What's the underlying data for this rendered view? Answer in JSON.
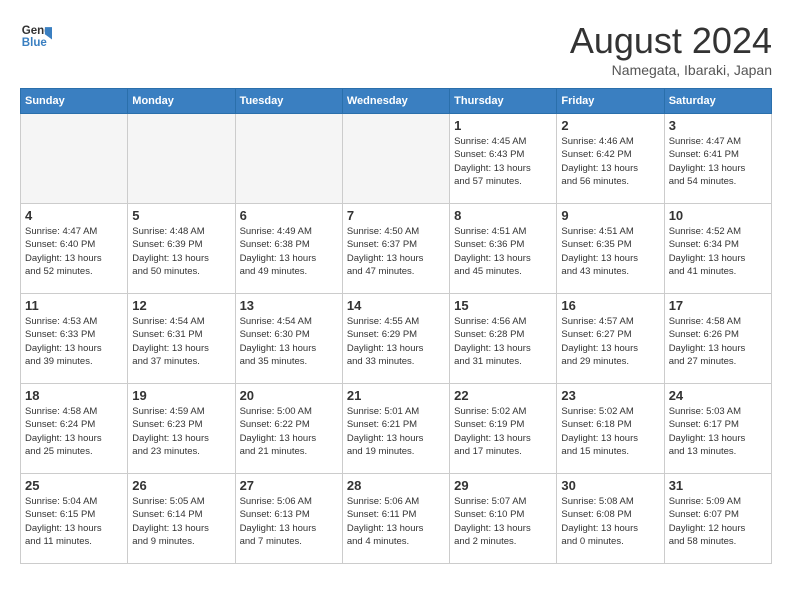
{
  "logo": {
    "line1": "General",
    "line2": "Blue"
  },
  "title": "August 2024",
  "subtitle": "Namegata, Ibaraki, Japan",
  "days_of_week": [
    "Sunday",
    "Monday",
    "Tuesday",
    "Wednesday",
    "Thursday",
    "Friday",
    "Saturday"
  ],
  "weeks": [
    [
      {
        "day": "",
        "info": ""
      },
      {
        "day": "",
        "info": ""
      },
      {
        "day": "",
        "info": ""
      },
      {
        "day": "",
        "info": ""
      },
      {
        "day": "1",
        "info": "Sunrise: 4:45 AM\nSunset: 6:43 PM\nDaylight: 13 hours\nand 57 minutes."
      },
      {
        "day": "2",
        "info": "Sunrise: 4:46 AM\nSunset: 6:42 PM\nDaylight: 13 hours\nand 56 minutes."
      },
      {
        "day": "3",
        "info": "Sunrise: 4:47 AM\nSunset: 6:41 PM\nDaylight: 13 hours\nand 54 minutes."
      }
    ],
    [
      {
        "day": "4",
        "info": "Sunrise: 4:47 AM\nSunset: 6:40 PM\nDaylight: 13 hours\nand 52 minutes."
      },
      {
        "day": "5",
        "info": "Sunrise: 4:48 AM\nSunset: 6:39 PM\nDaylight: 13 hours\nand 50 minutes."
      },
      {
        "day": "6",
        "info": "Sunrise: 4:49 AM\nSunset: 6:38 PM\nDaylight: 13 hours\nand 49 minutes."
      },
      {
        "day": "7",
        "info": "Sunrise: 4:50 AM\nSunset: 6:37 PM\nDaylight: 13 hours\nand 47 minutes."
      },
      {
        "day": "8",
        "info": "Sunrise: 4:51 AM\nSunset: 6:36 PM\nDaylight: 13 hours\nand 45 minutes."
      },
      {
        "day": "9",
        "info": "Sunrise: 4:51 AM\nSunset: 6:35 PM\nDaylight: 13 hours\nand 43 minutes."
      },
      {
        "day": "10",
        "info": "Sunrise: 4:52 AM\nSunset: 6:34 PM\nDaylight: 13 hours\nand 41 minutes."
      }
    ],
    [
      {
        "day": "11",
        "info": "Sunrise: 4:53 AM\nSunset: 6:33 PM\nDaylight: 13 hours\nand 39 minutes."
      },
      {
        "day": "12",
        "info": "Sunrise: 4:54 AM\nSunset: 6:31 PM\nDaylight: 13 hours\nand 37 minutes."
      },
      {
        "day": "13",
        "info": "Sunrise: 4:54 AM\nSunset: 6:30 PM\nDaylight: 13 hours\nand 35 minutes."
      },
      {
        "day": "14",
        "info": "Sunrise: 4:55 AM\nSunset: 6:29 PM\nDaylight: 13 hours\nand 33 minutes."
      },
      {
        "day": "15",
        "info": "Sunrise: 4:56 AM\nSunset: 6:28 PM\nDaylight: 13 hours\nand 31 minutes."
      },
      {
        "day": "16",
        "info": "Sunrise: 4:57 AM\nSunset: 6:27 PM\nDaylight: 13 hours\nand 29 minutes."
      },
      {
        "day": "17",
        "info": "Sunrise: 4:58 AM\nSunset: 6:26 PM\nDaylight: 13 hours\nand 27 minutes."
      }
    ],
    [
      {
        "day": "18",
        "info": "Sunrise: 4:58 AM\nSunset: 6:24 PM\nDaylight: 13 hours\nand 25 minutes."
      },
      {
        "day": "19",
        "info": "Sunrise: 4:59 AM\nSunset: 6:23 PM\nDaylight: 13 hours\nand 23 minutes."
      },
      {
        "day": "20",
        "info": "Sunrise: 5:00 AM\nSunset: 6:22 PM\nDaylight: 13 hours\nand 21 minutes."
      },
      {
        "day": "21",
        "info": "Sunrise: 5:01 AM\nSunset: 6:21 PM\nDaylight: 13 hours\nand 19 minutes."
      },
      {
        "day": "22",
        "info": "Sunrise: 5:02 AM\nSunset: 6:19 PM\nDaylight: 13 hours\nand 17 minutes."
      },
      {
        "day": "23",
        "info": "Sunrise: 5:02 AM\nSunset: 6:18 PM\nDaylight: 13 hours\nand 15 minutes."
      },
      {
        "day": "24",
        "info": "Sunrise: 5:03 AM\nSunset: 6:17 PM\nDaylight: 13 hours\nand 13 minutes."
      }
    ],
    [
      {
        "day": "25",
        "info": "Sunrise: 5:04 AM\nSunset: 6:15 PM\nDaylight: 13 hours\nand 11 minutes."
      },
      {
        "day": "26",
        "info": "Sunrise: 5:05 AM\nSunset: 6:14 PM\nDaylight: 13 hours\nand 9 minutes."
      },
      {
        "day": "27",
        "info": "Sunrise: 5:06 AM\nSunset: 6:13 PM\nDaylight: 13 hours\nand 7 minutes."
      },
      {
        "day": "28",
        "info": "Sunrise: 5:06 AM\nSunset: 6:11 PM\nDaylight: 13 hours\nand 4 minutes."
      },
      {
        "day": "29",
        "info": "Sunrise: 5:07 AM\nSunset: 6:10 PM\nDaylight: 13 hours\nand 2 minutes."
      },
      {
        "day": "30",
        "info": "Sunrise: 5:08 AM\nSunset: 6:08 PM\nDaylight: 13 hours\nand 0 minutes."
      },
      {
        "day": "31",
        "info": "Sunrise: 5:09 AM\nSunset: 6:07 PM\nDaylight: 12 hours\nand 58 minutes."
      }
    ]
  ]
}
